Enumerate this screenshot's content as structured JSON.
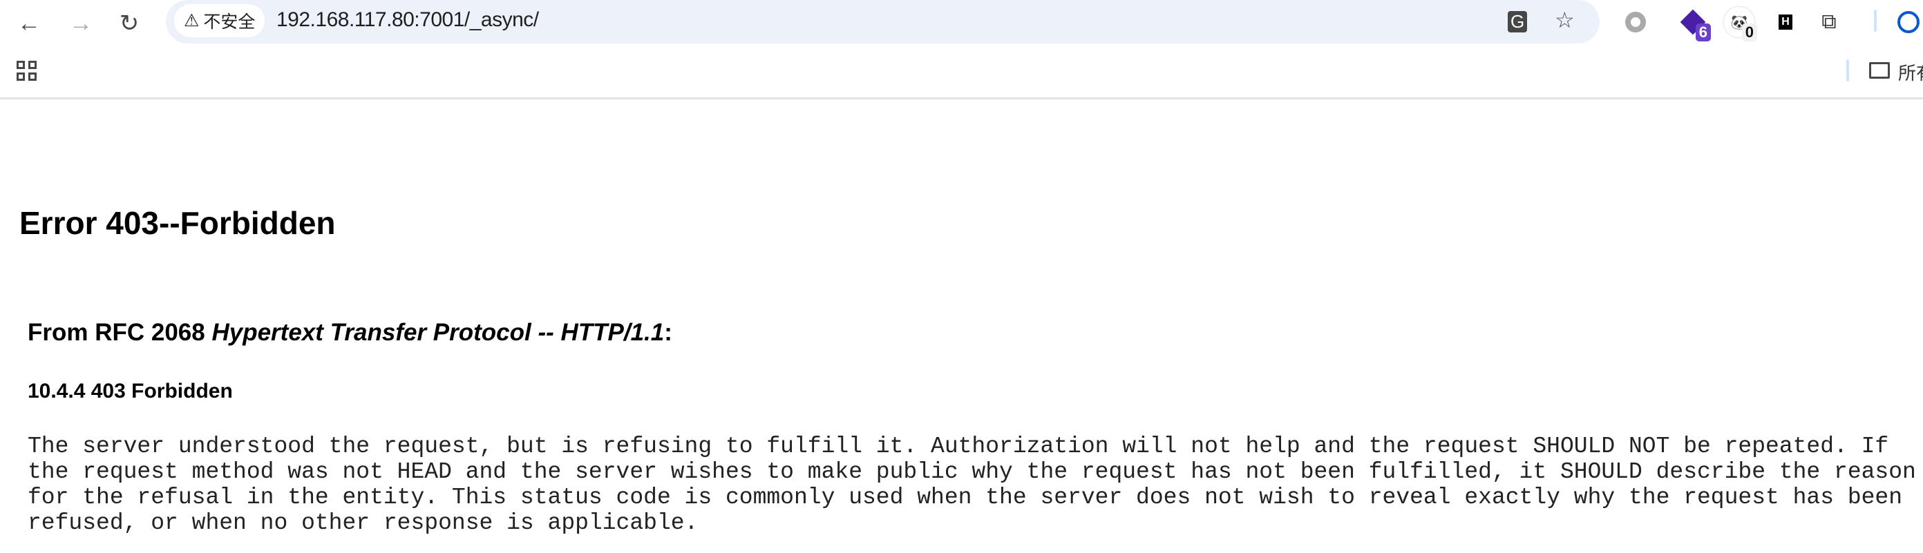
{
  "browser": {
    "security_label": "不安全",
    "url": "192.168.117.80:7001/_async/",
    "extensions": [
      {
        "name": "circle-extension",
        "badge": ""
      },
      {
        "name": "stack-extension",
        "badge": "6",
        "color": "#6b3fc9"
      },
      {
        "name": "panda-extension",
        "badge": "0"
      },
      {
        "name": "h-extension",
        "badge": ""
      }
    ],
    "bookmarks_folder_label": "所有书签"
  },
  "page": {
    "title": "Error 403--Forbidden",
    "rfc_prefix": "From RFC 2068 ",
    "rfc_title": "Hypertext Transfer Protocol -- HTTP/1.1",
    "rfc_suffix": ":",
    "section": "10.4.4 403 Forbidden",
    "body": "The server understood the request, but is refusing to fulfill it. Authorization will not help and the request SHOULD NOT be repeated. If the request method was not HEAD and the server wishes to make public why the request has not been fulfilled, it SHOULD describe the reason for the refusal in the entity. This status code is commonly used when the server does not wish to reveal exactly why the request has been refused, or when no other response is applicable."
  }
}
